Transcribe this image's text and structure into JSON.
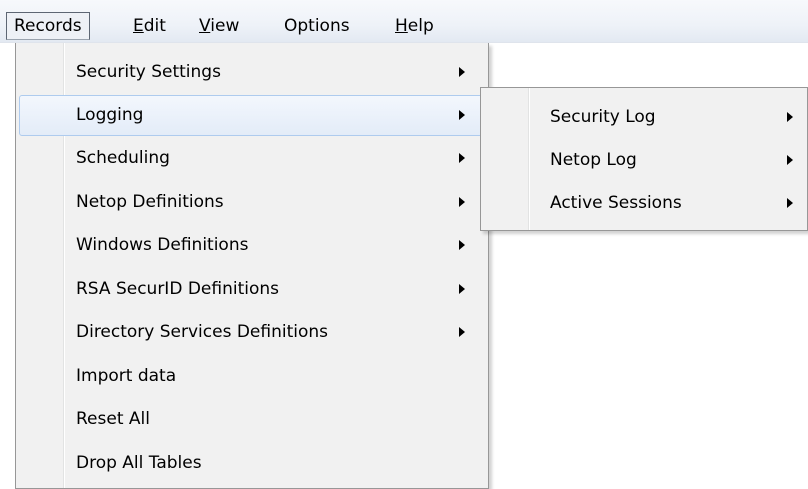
{
  "menubar": {
    "items": [
      {
        "label": "Records"
      },
      {
        "label": "Edit"
      },
      {
        "label": "View"
      },
      {
        "label": "Options"
      },
      {
        "label": "Help"
      }
    ]
  },
  "records_menu": {
    "items": [
      {
        "label": "Security Settings",
        "has_submenu": true
      },
      {
        "label": "Logging",
        "has_submenu": true,
        "highlighted": true
      },
      {
        "label": "Scheduling",
        "has_submenu": true
      },
      {
        "label": "Netop Definitions",
        "has_submenu": true
      },
      {
        "label": "Windows Definitions",
        "has_submenu": true
      },
      {
        "label": "RSA SecurID Definitions",
        "has_submenu": true
      },
      {
        "label": "Directory Services Definitions",
        "has_submenu": true
      },
      {
        "label": "Import data",
        "has_submenu": false
      },
      {
        "label": "Reset All",
        "has_submenu": false
      },
      {
        "label": "Drop All Tables",
        "has_submenu": false
      }
    ]
  },
  "logging_submenu": {
    "items": [
      {
        "label": "Security Log",
        "has_submenu": true
      },
      {
        "label": "Netop Log",
        "has_submenu": true
      },
      {
        "label": "Active Sessions",
        "has_submenu": true
      }
    ]
  },
  "colors": {
    "menu_background": "#f1f1f1",
    "menu_border": "#979797",
    "highlight_border": "#aecbee",
    "menubar_background": "#eef2f8"
  },
  "icons": {
    "submenu_arrow": "triangle-right"
  }
}
